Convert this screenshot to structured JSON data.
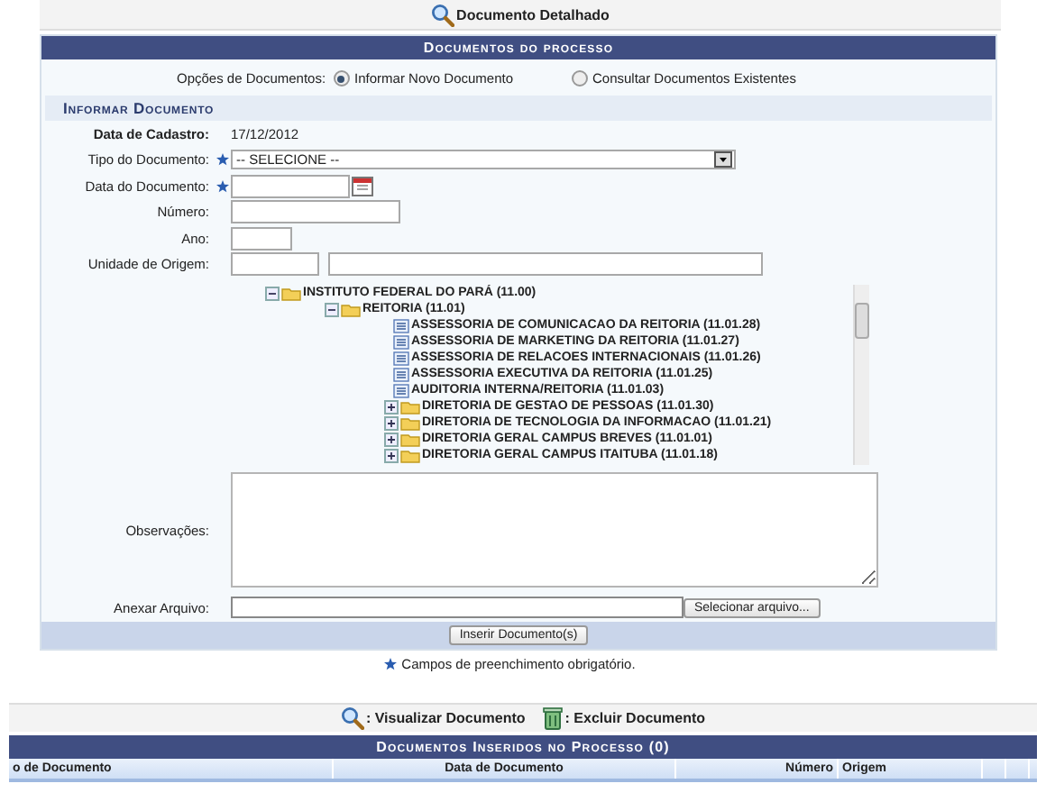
{
  "top_bar": {
    "legend": "Documento Detalhado"
  },
  "panel": {
    "title": "Documentos do processo",
    "options": {
      "label": "Opções de Documentos:",
      "choices": [
        {
          "label": "Informar Novo Documento",
          "selected": true
        },
        {
          "label": "Consultar Documentos Existentes",
          "selected": false
        }
      ]
    },
    "section_title": "Informar Documento",
    "fields": [
      {
        "kind": "static",
        "label": "Data de Cadastro:",
        "value": "17/12/2012"
      },
      {
        "kind": "select",
        "label": "Tipo do Documento:",
        "required": true,
        "value": "-- SELECIONE --"
      },
      {
        "kind": "date",
        "label": "Data do Documento:",
        "required": true
      },
      {
        "kind": "text",
        "label": "Número:",
        "required": false
      },
      {
        "kind": "short",
        "label": "Ano:",
        "required": false
      },
      {
        "kind": "unit",
        "label": "Unidade de Origem:",
        "required": false
      }
    ],
    "tree": [
      {
        "kind": "unit",
        "label": "INSTITUTO FEDERAL DO PARÁ (11.00)",
        "expanded": true,
        "children": [
          {
            "kind": "unit",
            "label": "REITORIA (11.01)",
            "expanded": true,
            "children": [
              {
                "kind": "leaf",
                "label": "ASSESSORIA DE COMUNICACAO DA REITORIA (11.01.28)"
              },
              {
                "kind": "leaf",
                "label": "ASSESSORIA DE MARKETING DA REITORIA (11.01.27)"
              },
              {
                "kind": "leaf",
                "label": "ASSESSORIA DE RELACOES INTERNACIONAIS (11.01.26)"
              },
              {
                "kind": "leaf",
                "label": "ASSESSORIA EXECUTIVA DA REITORIA (11.01.25)"
              },
              {
                "kind": "leaf",
                "label": "AUDITORIA INTERNA/REITORIA (11.01.03)"
              },
              {
                "kind": "unit",
                "label": "DIRETORIA DE GESTAO DE PESSOAS (11.01.30)",
                "expanded": false
              },
              {
                "kind": "unit",
                "label": "DIRETORIA DE TECNOLOGIA DA INFORMACAO (11.01.21)",
                "expanded": false
              },
              {
                "kind": "unit",
                "label": "DIRETORIA GERAL CAMPUS BREVES (11.01.01)",
                "expanded": false
              },
              {
                "kind": "unit",
                "label": "DIRETORIA GERAL CAMPUS ITAITUBA (11.01.18)",
                "expanded": false
              }
            ]
          }
        ]
      }
    ],
    "notes_label": "Observações:",
    "attach": {
      "label": "Anexar Arquivo:",
      "button": "Selecionar arquivo..."
    },
    "submit": "Inserir Documento(s)"
  },
  "required_note": "Campos de preenchimento obrigatório.",
  "legend": [
    {
      "kind": "view",
      "label": ": Visualizar Documento"
    },
    {
      "kind": "delete",
      "label": ": Excluir Documento"
    }
  ],
  "table": {
    "title": "Documentos Inseridos no Processo (0)",
    "columns": [
      "o de Documento",
      "Data de Documento",
      "Número",
      "Origem"
    ]
  }
}
